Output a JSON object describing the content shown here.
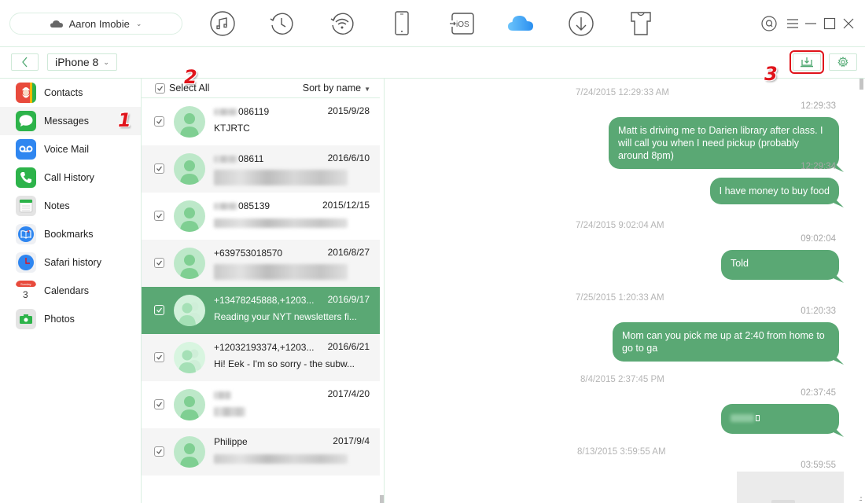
{
  "header": {
    "account_name": "Aaron Imobie",
    "toolbar_icons": [
      "itunes-library-icon",
      "itunes-backup-icon",
      "air-backup-icon",
      "device-manager-icon",
      "ios-mover-icon",
      "icloud-manager-icon",
      "video-downloader-icon",
      "ringtone-maker-icon"
    ],
    "active_tool": "icloud-manager-icon",
    "window_controls": [
      "search-icon",
      "menu-icon",
      "minimize-icon",
      "maximize-icon",
      "close-icon"
    ]
  },
  "subbar": {
    "back_label": "<",
    "device_label": "iPhone 8",
    "export_tooltip": "To Computer",
    "settings_tooltip": "Settings"
  },
  "sidebar": {
    "items": [
      {
        "label": "Contacts",
        "icon": "contacts-icon"
      },
      {
        "label": "Messages",
        "icon": "messages-icon",
        "active": true
      },
      {
        "label": "Voice Mail",
        "icon": "voicemail-icon"
      },
      {
        "label": "Call History",
        "icon": "call-history-icon"
      },
      {
        "label": "Notes",
        "icon": "notes-icon"
      },
      {
        "label": "Bookmarks",
        "icon": "bookmarks-icon"
      },
      {
        "label": "Safari history",
        "icon": "safari-history-icon"
      },
      {
        "label": "Calendars",
        "icon": "calendars-icon"
      },
      {
        "label": "Photos",
        "icon": "photos-icon"
      }
    ]
  },
  "annotations": {
    "one": "1",
    "two": "2",
    "three": "3"
  },
  "list": {
    "select_all_label": "Select All",
    "sort_label": "Sort by name",
    "conversations": [
      {
        "name": "086119",
        "name_blurred_prefix": true,
        "date": "2015/9/28",
        "snippet": "KTJRTC",
        "group": false,
        "checked": true
      },
      {
        "name": "08611",
        "name_blurred_prefix": true,
        "date": "2016/6/10",
        "snippet": "",
        "snippet_blurred": true,
        "group": false,
        "checked": true
      },
      {
        "name": "085139",
        "name_blurred_prefix": true,
        "date": "2015/12/15",
        "snippet": "",
        "snippet_blurred": true,
        "group": false,
        "checked": true
      },
      {
        "name": "+639753018570",
        "date": "2016/8/27",
        "snippet": "",
        "snippet_blurred": true,
        "group": false,
        "checked": true
      },
      {
        "name": "+13478245888,+1203...",
        "date": "2016/9/17",
        "snippet": "Reading your NYT newsletters fi...",
        "group": true,
        "checked": true,
        "selected": true
      },
      {
        "name": "+12032193374,+1203...",
        "date": "2016/6/21",
        "snippet": "Hi! Eek - I'm so sorry - the subw...",
        "group": true,
        "checked": true
      },
      {
        "name": "",
        "name_blurred": true,
        "date": "2017/4/20",
        "snippet": "",
        "snippet_blurred": true,
        "group": false,
        "checked": true
      },
      {
        "name": "Philippe",
        "date": "2017/9/4",
        "snippet": "",
        "snippet_blurred": true,
        "group": false,
        "checked": true
      }
    ]
  },
  "chat": {
    "messages": [
      {
        "date_header": "7/24/2015 12:29:33 AM",
        "time": "12:29:33",
        "text": "Matt is driving me to Darien library after class. I will call you when I need pickup (probably around 8pm)"
      },
      {
        "time": "12:29:34",
        "text": "I have money to buy food"
      },
      {
        "date_header": "7/24/2015 9:02:04 AM",
        "time": "09:02:04",
        "text": "Told"
      },
      {
        "date_header": "7/25/2015 1:20:33 AM",
        "time": "01:20:33",
        "text": "Mom can you pick me up at 2:40 from home to go to ga"
      },
      {
        "date_header": "8/4/2015 2:37:45 PM",
        "time": "02:37:45",
        "text": "",
        "text_blurred": true
      },
      {
        "date_header": "8/13/2015 3:59:55 AM",
        "time": "03:59:55",
        "attachment": "image"
      }
    ]
  },
  "colors": {
    "accent_green": "#5aa874",
    "avatar_green": "#bde8c9",
    "border_green": "#d9efe1",
    "icloud_blue": "#2b9af3",
    "annotation_red": "#e0141b"
  }
}
